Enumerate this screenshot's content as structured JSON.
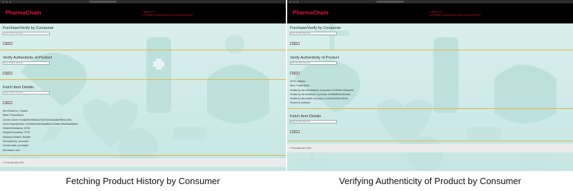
{
  "captions": {
    "left": "Fetching Product History by Consumer",
    "right": "Verifying Authenticity of Product by Consumer"
  },
  "app": {
    "brand": "PharmaChain",
    "account_label": "Logged in as:",
    "account_address": "0xF6e9a0b1c2d3e4f5A6b7C8d9E0f1a2B3c4D5e6F7"
  },
  "left": {
    "sections": {
      "verify_consumer": {
        "title": "Purchase/Verify by Consumer",
        "placeholder": "Enter Product Serial No.",
        "button": "Submit"
      },
      "authenticity": {
        "title": "Verify Authenticity of Product",
        "placeholder": "Enter Product Serial No.",
        "button": "Submit"
      },
      "details": {
        "title": "Fetch Item Details",
        "placeholder": "Enter Product Serial No.",
        "button": "Submit"
      }
    },
    "details_lines": [
      "Item Serial No.: 3 Batch",
      "Name: Paracetamol",
      "Current Owner: 0x2a8c9e1f4b6d3a7c5e0f1b2d4c6a8e9f0b1c2d3e",
      "Owner Manufacturer: 0x1f3e5d7c9b2a4e6f8d0c1b3a5e7d9c2f4a6b8e0d",
      "Ordered timestamp: 20:45",
      "Shipped timestamp: 22:15",
      "Delivered Retailer: Retailer",
      "Purchased by: consumer",
      "Current state: purchased",
      "Item status: sold"
    ],
    "footer": "© PharmaChain 2023"
  },
  "right": {
    "sections": {
      "verify_consumer": {
        "title": "Purchase/Verify by Consumer",
        "placeholder": "Enter Product Serial No.",
        "button": "Submit"
      },
      "authenticity": {
        "title": "Verify Authenticity of Product",
        "placeholder": "Enter Product Serial No.",
        "button": "Submit"
      },
      "details": {
        "title": "Fetch Item Details",
        "placeholder": "Enter Product Serial No.",
        "button": "Submit"
      }
    },
    "auth_lines": [
      "UPC/Lot/Batch",
      "Item: Cough Syrup",
      "Verified by the manufacturer of product: 0x1f3e5d7c9b2a4e6f",
      "Verified by the distributor of product: 0x4b6d8f0a2c4e6a8c",
      "Verified by the retailer of product: 0x7e9a1c3e5a7c9e1b",
      "Product is authentic"
    ],
    "footer": "© PharmaChain 2023"
  }
}
